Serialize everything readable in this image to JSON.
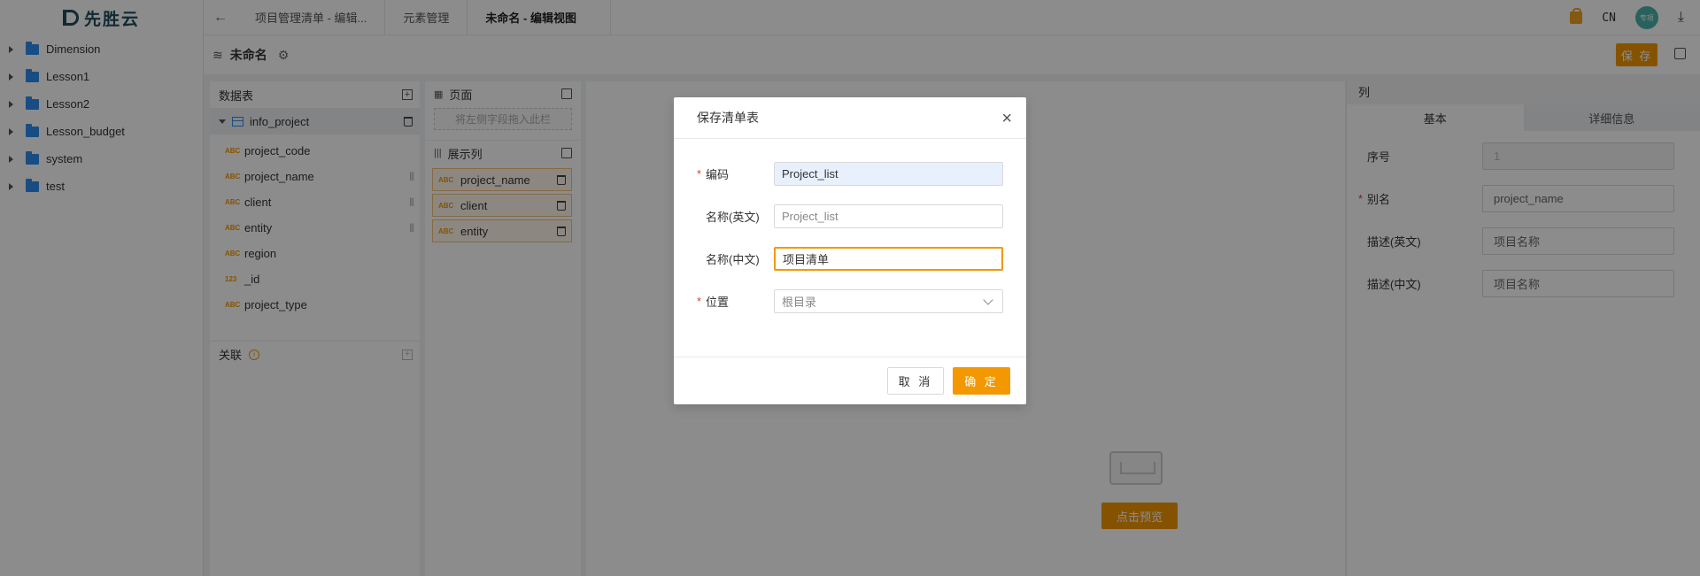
{
  "brand": {
    "name": "先胜云"
  },
  "tree": {
    "items": [
      {
        "label": "Dimension"
      },
      {
        "label": "Lesson1"
      },
      {
        "label": "Lesson2"
      },
      {
        "label": "Lesson_budget"
      },
      {
        "label": "system"
      },
      {
        "label": "test"
      }
    ]
  },
  "topbar": {
    "back_icon": "arrow-left-icon",
    "tabs": [
      {
        "label": "项目管理清单 - 编辑..."
      },
      {
        "label": "元素管理"
      },
      {
        "label": "未命名 - 编辑视图"
      }
    ],
    "lang": "CN",
    "avatar_text": "专项"
  },
  "subheader": {
    "title": "未命名",
    "save_label": "保 存"
  },
  "data_panel": {
    "title": "数据表",
    "table_name": "info_project",
    "fields": [
      {
        "type": "ABC",
        "name": "project_code",
        "draggable": false
      },
      {
        "type": "ABC",
        "name": "project_name",
        "draggable": true
      },
      {
        "type": "ABC",
        "name": "client",
        "draggable": true
      },
      {
        "type": "ABC",
        "name": "entity",
        "draggable": true
      },
      {
        "type": "ABC",
        "name": "region",
        "draggable": false
      },
      {
        "type": "123",
        "name": "_id",
        "draggable": false
      },
      {
        "type": "ABC",
        "name": "project_type",
        "draggable": false
      }
    ],
    "relation_title": "关联"
  },
  "column_panel": {
    "page_title": "页面",
    "drop_placeholder": "将左侧字段拖入此栏",
    "display_title": "展示列",
    "columns": [
      {
        "type": "ABC",
        "name": "project_name"
      },
      {
        "type": "ABC",
        "name": "client"
      },
      {
        "type": "ABC",
        "name": "entity"
      }
    ]
  },
  "preview": {
    "button_label": "点击预览"
  },
  "props": {
    "title": "列",
    "tabs": [
      {
        "label": "基本"
      },
      {
        "label": "详细信息"
      }
    ],
    "rows": [
      {
        "label": "序号",
        "value": "1",
        "required": false,
        "disabled": true
      },
      {
        "label": "别名",
        "value": "project_name",
        "required": true,
        "disabled": false
      },
      {
        "label": "描述(英文)",
        "value": "项目名称",
        "required": false,
        "disabled": false
      },
      {
        "label": "描述(中文)",
        "value": "项目名称",
        "required": false,
        "disabled": false
      }
    ]
  },
  "modal": {
    "title": "保存清单表",
    "fields": {
      "code": {
        "label": "编码",
        "value": "Project_list"
      },
      "name_en": {
        "label": "名称(英文)",
        "value": "Project_list"
      },
      "name_cn": {
        "label": "名称(中文)",
        "value": "项目清单"
      },
      "location": {
        "label": "位置",
        "value": "根目录"
      }
    },
    "cancel_label": "取 消",
    "ok_label": "确 定"
  },
  "colors": {
    "accent": "#f39800",
    "folder": "#2d8cf0",
    "required": "#e4393c"
  }
}
